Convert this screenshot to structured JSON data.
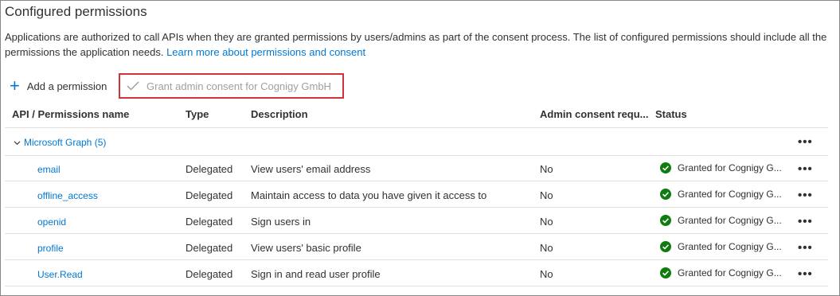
{
  "section": {
    "title": "Configured permissions",
    "description": "Applications are authorized to call APIs when they are granted permissions by users/admins as part of the consent process. The list of configured permissions should include all the permissions the application needs.",
    "learn_more": "Learn more about permissions and consent"
  },
  "toolbar": {
    "add_label": "Add a permission",
    "grant_label": "Grant admin consent for Cognigy GmbH",
    "colors": {
      "accent": "#0078d4",
      "highlight_border": "#d13438",
      "disabled_text": "#a19f9d"
    }
  },
  "table": {
    "headers": [
      "API / Permissions name",
      "Type",
      "Description",
      "Admin consent requ...",
      "Status"
    ],
    "group": {
      "label": "Microsoft Graph (5)",
      "icon": "chevron-down-icon"
    },
    "rows": [
      {
        "name": "email",
        "type": "Delegated",
        "description": "View users' email address",
        "admin": "No",
        "status": "Granted for Cognigy G..."
      },
      {
        "name": "offline_access",
        "type": "Delegated",
        "description": "Maintain access to data you have given it access to",
        "admin": "No",
        "status": "Granted for Cognigy G..."
      },
      {
        "name": "openid",
        "type": "Delegated",
        "description": "Sign users in",
        "admin": "No",
        "status": "Granted for Cognigy G..."
      },
      {
        "name": "profile",
        "type": "Delegated",
        "description": "View users' basic profile",
        "admin": "No",
        "status": "Granted for Cognigy G..."
      },
      {
        "name": "User.Read",
        "type": "Delegated",
        "description": "Sign in and read user profile",
        "admin": "No",
        "status": "Granted for Cognigy G..."
      }
    ],
    "more_label": "•••",
    "status_color": "#107c10"
  }
}
